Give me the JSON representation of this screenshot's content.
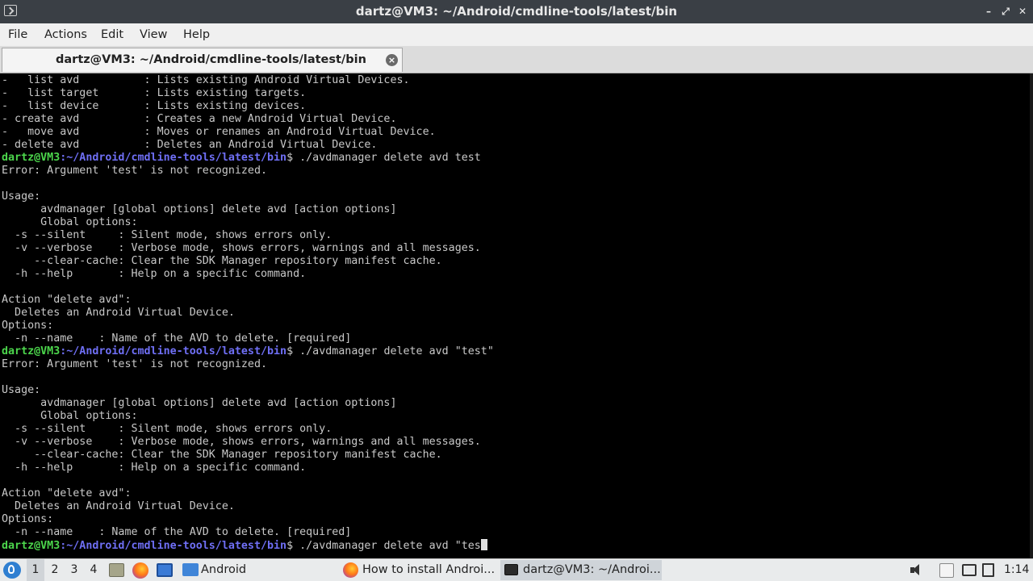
{
  "window": {
    "title": "dartz@VM3: ~/Android/cmdline-tools/latest/bin",
    "controls": [
      "–",
      "⤢",
      "✕"
    ]
  },
  "menubar": {
    "items": [
      "File",
      "Actions",
      "Edit",
      "View",
      "Help"
    ]
  },
  "tab": {
    "label": "dartz@VM3: ~/Android/cmdline-tools/latest/bin",
    "close_symbol": "×"
  },
  "terminal": {
    "lines": [
      {
        "text": "-   list avd          : Lists existing Android Virtual Devices."
      },
      {
        "text": "-   list target       : Lists existing targets."
      },
      {
        "text": "-   list device       : Lists existing devices."
      },
      {
        "text": "- create avd          : Creates a new Android Virtual Device."
      },
      {
        "text": "-   move avd          : Moves or renames an Android Virtual Device."
      },
      {
        "text": "- delete avd          : Deletes an Android Virtual Device."
      },
      {
        "prompt_user": "dartz@VM3",
        "prompt_path": ":~/Android/cmdline-tools/latest/bin",
        "text": "$ ./avdmanager delete avd test"
      },
      {
        "text": "Error: Argument 'test' is not recognized."
      },
      {
        "text": ""
      },
      {
        "text": "Usage:"
      },
      {
        "text": "      avdmanager [global options] delete avd [action options]"
      },
      {
        "text": "      Global options:"
      },
      {
        "text": "  -s --silent     : Silent mode, shows errors only."
      },
      {
        "text": "  -v --verbose    : Verbose mode, shows errors, warnings and all messages."
      },
      {
        "text": "     --clear-cache: Clear the SDK Manager repository manifest cache."
      },
      {
        "text": "  -h --help       : Help on a specific command."
      },
      {
        "text": ""
      },
      {
        "text": "Action \"delete avd\":"
      },
      {
        "text": "  Deletes an Android Virtual Device."
      },
      {
        "text": "Options:"
      },
      {
        "text": "  -n --name    : Name of the AVD to delete. [required]"
      },
      {
        "prompt_user": "dartz@VM3",
        "prompt_path": ":~/Android/cmdline-tools/latest/bin",
        "text": "$ ./avdmanager delete avd \"test\""
      },
      {
        "text": "Error: Argument 'test' is not recognized."
      },
      {
        "text": ""
      },
      {
        "text": "Usage:"
      },
      {
        "text": "      avdmanager [global options] delete avd [action options]"
      },
      {
        "text": "      Global options:"
      },
      {
        "text": "  -s --silent     : Silent mode, shows errors only."
      },
      {
        "text": "  -v --verbose    : Verbose mode, shows errors, warnings and all messages."
      },
      {
        "text": "     --clear-cache: Clear the SDK Manager repository manifest cache."
      },
      {
        "text": "  -h --help       : Help on a specific command."
      },
      {
        "text": ""
      },
      {
        "text": "Action \"delete avd\":"
      },
      {
        "text": "  Deletes an Android Virtual Device."
      },
      {
        "text": "Options:"
      },
      {
        "text": "  -n --name    : Name of the AVD to delete. [required]"
      },
      {
        "prompt_user": "dartz@VM3",
        "prompt_path": ":~/Android/cmdline-tools/latest/bin",
        "text": "$ ./avdmanager delete avd \"tes",
        "cursor": true
      }
    ]
  },
  "taskbar": {
    "workspaces": [
      "1",
      "2",
      "3",
      "4"
    ],
    "active_workspace": "1",
    "tasks": [
      {
        "label": "Android",
        "icon": "folder-icon"
      },
      {
        "label": "How to install Androi...",
        "icon": "firefox-icon"
      },
      {
        "label": "dartz@VM3: ~/Androi...",
        "icon": "terminal-icon",
        "active": true
      }
    ],
    "clock": "1:14"
  },
  "colors": {
    "prompt_user": "#4cd64c",
    "prompt_path": "#6f6ff5",
    "terminal_bg": "#000000",
    "terminal_fg": "#c8c8c8",
    "titlebar_bg": "#3a3f45"
  }
}
